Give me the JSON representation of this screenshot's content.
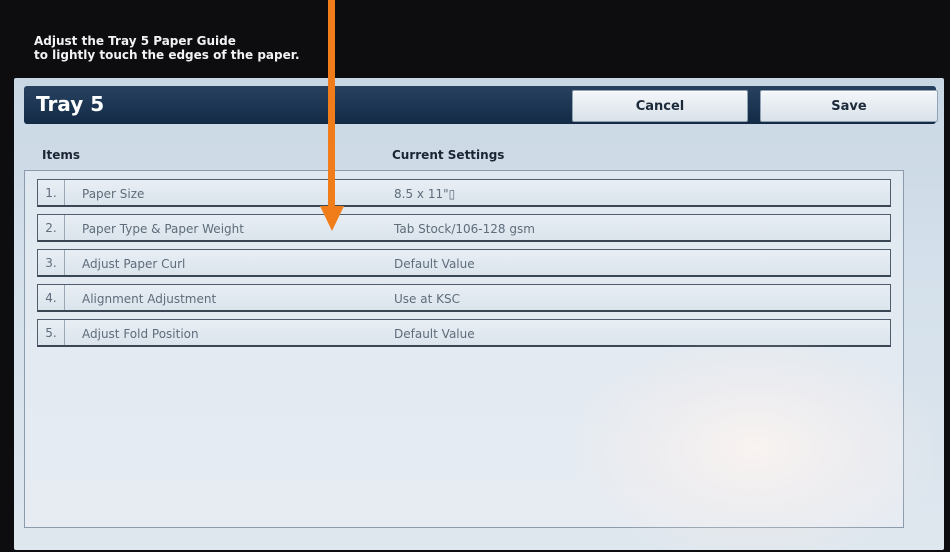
{
  "instruction": {
    "text": "Adjust the Tray 5 Paper Guide\nto lightly touch the edges of the paper."
  },
  "header": {
    "title": "Tray 5",
    "cancel_label": "Cancel",
    "save_label": "Save"
  },
  "columns": {
    "items": "Items",
    "settings": "Current Settings"
  },
  "rows": [
    {
      "num": "1.",
      "name": "Paper Size",
      "value": "8.5 x 11\"▯"
    },
    {
      "num": "2.",
      "name": "Paper Type & Paper Weight",
      "value": "Tab Stock/106-128 gsm"
    },
    {
      "num": "3.",
      "name": "Adjust Paper Curl",
      "value": "Default Value"
    },
    {
      "num": "4.",
      "name": "Alignment Adjustment",
      "value": "Use at KSC"
    },
    {
      "num": "5.",
      "name": "Adjust Fold Position",
      "value": "Default Value"
    }
  ],
  "colors": {
    "header_bar": "#1b3552",
    "screen_bg": "#d4e0eb",
    "annotation_arrow": "#f07d1a"
  }
}
